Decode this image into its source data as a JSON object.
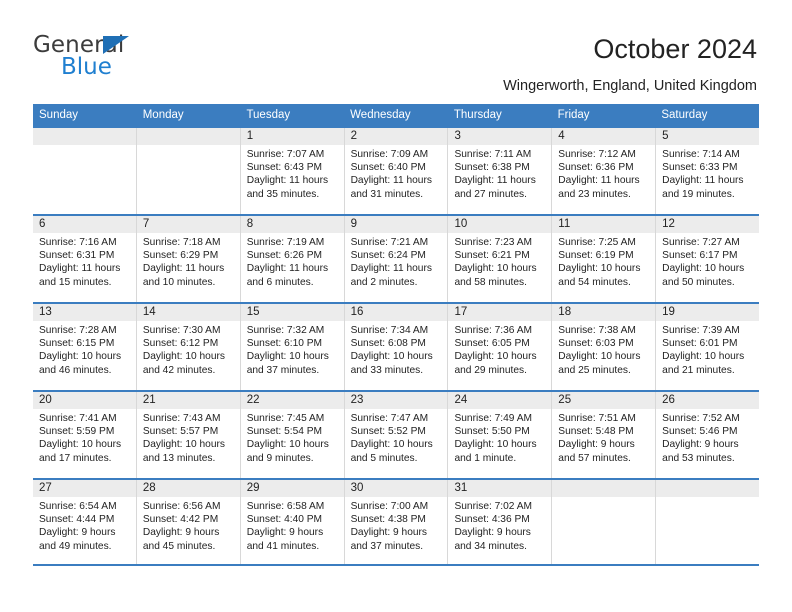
{
  "logo": {
    "word1": "General",
    "word2": "Blue",
    "triangle_color": "#1f6fb5",
    "blue_color": "#1f7fd0"
  },
  "header": {
    "title": "October 2024",
    "subtitle": "Wingerworth, England, United Kingdom"
  },
  "theme": {
    "header_blue": "#3b7dc0",
    "daynum_gray": "#ececec",
    "grid_line": "#d8d8d8"
  },
  "weekdays": [
    "Sunday",
    "Monday",
    "Tuesday",
    "Wednesday",
    "Thursday",
    "Friday",
    "Saturday"
  ],
  "weeks": [
    [
      {
        "day": "",
        "sunrise": "",
        "sunset": "",
        "daylight": "",
        "empty": true
      },
      {
        "day": "",
        "sunrise": "",
        "sunset": "",
        "daylight": "",
        "empty": true
      },
      {
        "day": "1",
        "sunrise": "Sunrise: 7:07 AM",
        "sunset": "Sunset: 6:43 PM",
        "daylight": "Daylight: 11 hours and 35 minutes."
      },
      {
        "day": "2",
        "sunrise": "Sunrise: 7:09 AM",
        "sunset": "Sunset: 6:40 PM",
        "daylight": "Daylight: 11 hours and 31 minutes."
      },
      {
        "day": "3",
        "sunrise": "Sunrise: 7:11 AM",
        "sunset": "Sunset: 6:38 PM",
        "daylight": "Daylight: 11 hours and 27 minutes."
      },
      {
        "day": "4",
        "sunrise": "Sunrise: 7:12 AM",
        "sunset": "Sunset: 6:36 PM",
        "daylight": "Daylight: 11 hours and 23 minutes."
      },
      {
        "day": "5",
        "sunrise": "Sunrise: 7:14 AM",
        "sunset": "Sunset: 6:33 PM",
        "daylight": "Daylight: 11 hours and 19 minutes."
      }
    ],
    [
      {
        "day": "6",
        "sunrise": "Sunrise: 7:16 AM",
        "sunset": "Sunset: 6:31 PM",
        "daylight": "Daylight: 11 hours and 15 minutes."
      },
      {
        "day": "7",
        "sunrise": "Sunrise: 7:18 AM",
        "sunset": "Sunset: 6:29 PM",
        "daylight": "Daylight: 11 hours and 10 minutes."
      },
      {
        "day": "8",
        "sunrise": "Sunrise: 7:19 AM",
        "sunset": "Sunset: 6:26 PM",
        "daylight": "Daylight: 11 hours and 6 minutes."
      },
      {
        "day": "9",
        "sunrise": "Sunrise: 7:21 AM",
        "sunset": "Sunset: 6:24 PM",
        "daylight": "Daylight: 11 hours and 2 minutes."
      },
      {
        "day": "10",
        "sunrise": "Sunrise: 7:23 AM",
        "sunset": "Sunset: 6:21 PM",
        "daylight": "Daylight: 10 hours and 58 minutes."
      },
      {
        "day": "11",
        "sunrise": "Sunrise: 7:25 AM",
        "sunset": "Sunset: 6:19 PM",
        "daylight": "Daylight: 10 hours and 54 minutes."
      },
      {
        "day": "12",
        "sunrise": "Sunrise: 7:27 AM",
        "sunset": "Sunset: 6:17 PM",
        "daylight": "Daylight: 10 hours and 50 minutes."
      }
    ],
    [
      {
        "day": "13",
        "sunrise": "Sunrise: 7:28 AM",
        "sunset": "Sunset: 6:15 PM",
        "daylight": "Daylight: 10 hours and 46 minutes."
      },
      {
        "day": "14",
        "sunrise": "Sunrise: 7:30 AM",
        "sunset": "Sunset: 6:12 PM",
        "daylight": "Daylight: 10 hours and 42 minutes."
      },
      {
        "day": "15",
        "sunrise": "Sunrise: 7:32 AM",
        "sunset": "Sunset: 6:10 PM",
        "daylight": "Daylight: 10 hours and 37 minutes."
      },
      {
        "day": "16",
        "sunrise": "Sunrise: 7:34 AM",
        "sunset": "Sunset: 6:08 PM",
        "daylight": "Daylight: 10 hours and 33 minutes."
      },
      {
        "day": "17",
        "sunrise": "Sunrise: 7:36 AM",
        "sunset": "Sunset: 6:05 PM",
        "daylight": "Daylight: 10 hours and 29 minutes."
      },
      {
        "day": "18",
        "sunrise": "Sunrise: 7:38 AM",
        "sunset": "Sunset: 6:03 PM",
        "daylight": "Daylight: 10 hours and 25 minutes."
      },
      {
        "day": "19",
        "sunrise": "Sunrise: 7:39 AM",
        "sunset": "Sunset: 6:01 PM",
        "daylight": "Daylight: 10 hours and 21 minutes."
      }
    ],
    [
      {
        "day": "20",
        "sunrise": "Sunrise: 7:41 AM",
        "sunset": "Sunset: 5:59 PM",
        "daylight": "Daylight: 10 hours and 17 minutes."
      },
      {
        "day": "21",
        "sunrise": "Sunrise: 7:43 AM",
        "sunset": "Sunset: 5:57 PM",
        "daylight": "Daylight: 10 hours and 13 minutes."
      },
      {
        "day": "22",
        "sunrise": "Sunrise: 7:45 AM",
        "sunset": "Sunset: 5:54 PM",
        "daylight": "Daylight: 10 hours and 9 minutes."
      },
      {
        "day": "23",
        "sunrise": "Sunrise: 7:47 AM",
        "sunset": "Sunset: 5:52 PM",
        "daylight": "Daylight: 10 hours and 5 minutes."
      },
      {
        "day": "24",
        "sunrise": "Sunrise: 7:49 AM",
        "sunset": "Sunset: 5:50 PM",
        "daylight": "Daylight: 10 hours and 1 minute."
      },
      {
        "day": "25",
        "sunrise": "Sunrise: 7:51 AM",
        "sunset": "Sunset: 5:48 PM",
        "daylight": "Daylight: 9 hours and 57 minutes."
      },
      {
        "day": "26",
        "sunrise": "Sunrise: 7:52 AM",
        "sunset": "Sunset: 5:46 PM",
        "daylight": "Daylight: 9 hours and 53 minutes."
      }
    ],
    [
      {
        "day": "27",
        "sunrise": "Sunrise: 6:54 AM",
        "sunset": "Sunset: 4:44 PM",
        "daylight": "Daylight: 9 hours and 49 minutes."
      },
      {
        "day": "28",
        "sunrise": "Sunrise: 6:56 AM",
        "sunset": "Sunset: 4:42 PM",
        "daylight": "Daylight: 9 hours and 45 minutes."
      },
      {
        "day": "29",
        "sunrise": "Sunrise: 6:58 AM",
        "sunset": "Sunset: 4:40 PM",
        "daylight": "Daylight: 9 hours and 41 minutes."
      },
      {
        "day": "30",
        "sunrise": "Sunrise: 7:00 AM",
        "sunset": "Sunset: 4:38 PM",
        "daylight": "Daylight: 9 hours and 37 minutes."
      },
      {
        "day": "31",
        "sunrise": "Sunrise: 7:02 AM",
        "sunset": "Sunset: 4:36 PM",
        "daylight": "Daylight: 9 hours and 34 minutes."
      },
      {
        "day": "",
        "sunrise": "",
        "sunset": "",
        "daylight": "",
        "empty": true
      },
      {
        "day": "",
        "sunrise": "",
        "sunset": "",
        "daylight": "",
        "empty": true
      }
    ]
  ]
}
